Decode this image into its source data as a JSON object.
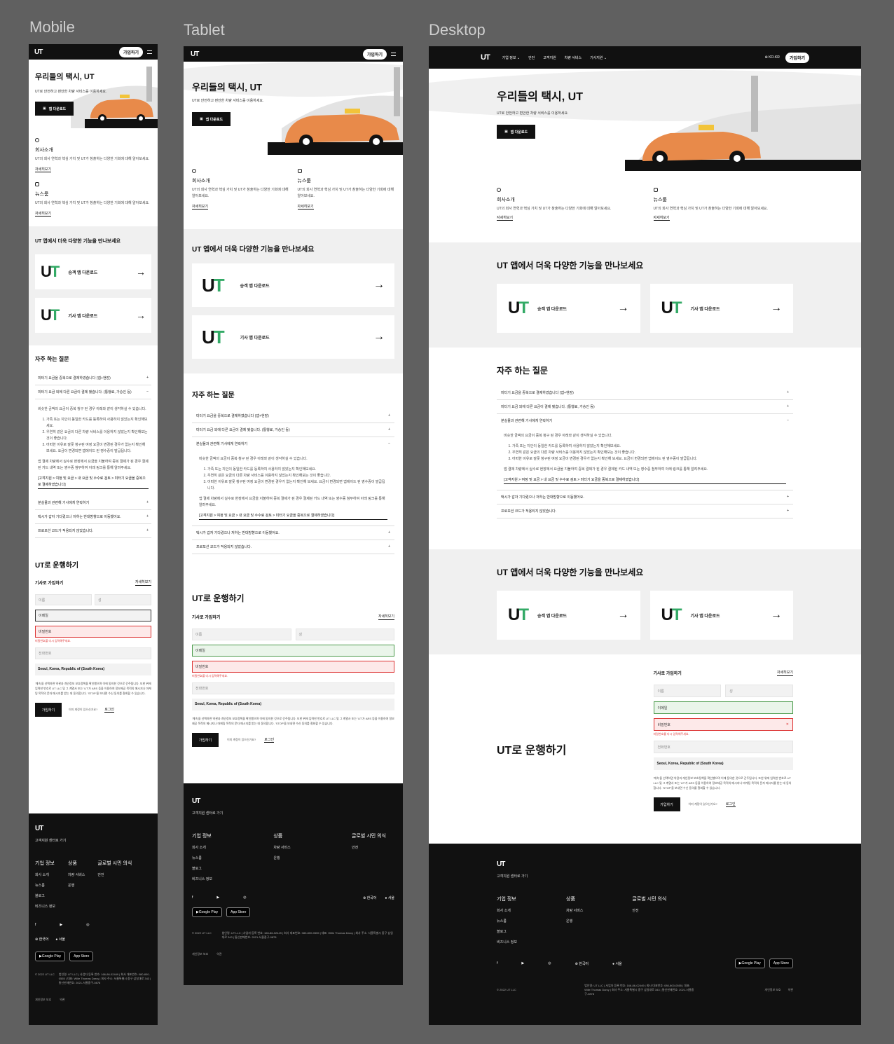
{
  "labels": {
    "mobile": "Mobile",
    "tablet": "Tablet",
    "desktop": "Desktop"
  },
  "brand": {
    "logo": "UT",
    "join": "가입하기"
  },
  "nav": {
    "items": [
      "기업 정보",
      "안전",
      "고객지원",
      "차량 서비스",
      "기사지원"
    ],
    "lang": "KO-KR"
  },
  "hero": {
    "title": "우리들의 택시, UT",
    "subtitle": "UT로 안전하고 편안한 차량 서비스를 이용하세요.",
    "button": "앱 다운로드"
  },
  "about": [
    {
      "title": "회사소개",
      "desc": "UT의 회사 연혁과 핵심 가치 및 UT가 창출하는 다양한 기회에 대해 알아보세요.",
      "link": "자세히보기"
    },
    {
      "title": "뉴스룸",
      "desc": "UT의 회사 연혁과 핵심 가치 및 UT가 창출하는 다양한 기회에 대해 알아보세요.",
      "link": "자세히보기"
    }
  ],
  "apps": {
    "title": "UT 앱에서 더욱 다양한 기능을 만나보세요",
    "passenger": "승객 앱 다운로드",
    "driver": "기사 앱 다운로드"
  },
  "faq": {
    "title": "자주 하는 질문",
    "q1": "미터기 요금을 중복으로 결제하였습니다 (앱+현장)",
    "q2": "미터기 요금 외에 다른 요금이 결제 됐습니다. (통행료, 가승인 등)",
    "q3": "분실물과 관련해 기사에게 연락하기",
    "q4": "택시가 갑자 기다렸으나 저하는 반대방향으로 이동했어요.",
    "q5": "프로모션 코드가 적용되지 않았습니다.",
    "a_intro": "비슷한 금액의 요금이 중복 청구 된 경우 아래와 같이 생각하실 수 있습니다.",
    "a_items": [
      "가족 또는 지인이 동일한 카드를 등록하여 사용하지 않았는지 확인해보세요.",
      "우연히 같은 요금의 다른 차량 서비스를 이용하지 않았는지 확인해보는 것이 좋습니다.",
      "어떠한 이유로 잘못 청구된 여정 요금이 변경된 경우가 없는지 확인해 보세요. 요금이 변경되면 앱에이드 된 영수증이 발급됩니다."
    ],
    "a_note": "앱 결제 차량에서 실수로 현장에서 요금을 지불하여 중복 결제가 된 경우 결제된 카드 내역 또는 영수증 첨부하여 아래 링크를 통해 알려주세요.",
    "a_link": "[고객지원 > 여정 및 요금 > 내 요금 및 수수료 검토 > 미터기 요금을 중복으로 결제하였습니다]"
  },
  "drive": {
    "title": "UT로 운행하기",
    "join_title": "기사로 가입하기",
    "more": "자세히보기",
    "last": "이름",
    "first": "성",
    "email": "이메일",
    "password": "비밀번호",
    "pw_error": "비밀번호를 다시 입력해주세요.",
    "phone": "전화번호",
    "city": "Seoul, Korea, Republic of (South Korea)",
    "terms": "'계속'을 선택하면 약관과 개인정보 보호정책을 확인했으며 이에 동의한 것으로 간주됩니다. 또한 위에 입력한 번호로 UT LLC 및 그 계열사 또는 'UT'가 ARS 등을 이용하여 정보제공 목적의 메시지나 마케팅 목적의 문자 메시지를 받는 데 동의합니다. 'STOP'을 보내면 수신 동의를 철회할 수 있습니다.",
    "submit": "가입하기",
    "have_account": "이미 계정이 있으신가요?",
    "login": "로그인"
  },
  "footer": {
    "support": "고객지원 센터로 가기",
    "col1_title": "기업 정보",
    "col1": [
      "회사 소개",
      "뉴스룸",
      "블로그",
      "비즈니스 정보"
    ],
    "col2_title": "상품",
    "col2": [
      "차량 서비스",
      "운행"
    ],
    "col3_title": "글로벌 시민 의식",
    "col3": [
      "안전"
    ],
    "lang": "한국어",
    "city": "서울",
    "google": "Google Play",
    "apple": "App Store",
    "copyright": "© 2022 UT LLC",
    "company": "법인명: UT LLC | 사업자 등록 번호: 166-86-02449 | 회사 대표번호: 080-800-0555 | 대표: Wille Thomas Darcy | 회사 주소: 서울특별시 중구 삼일대로 343 | 통신판매번호: 2021-서울중구-0878",
    "privacy": "개인정보 보호",
    "terms": "약관"
  },
  "colors": {
    "accent": "#e88a4a",
    "dark": "#111111",
    "error": "#dd3333",
    "ok": "#4a9a4a"
  }
}
